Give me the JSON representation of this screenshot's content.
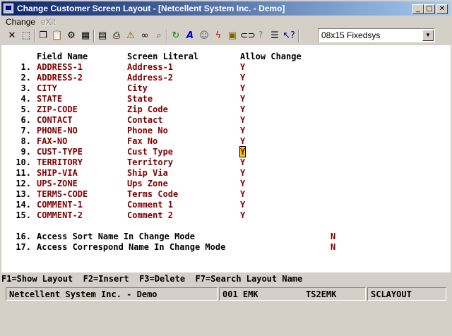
{
  "window": {
    "title": "Change Customer Screen Layout - [Netcellent System Inc. - Demo]"
  },
  "menu": {
    "items": [
      {
        "label": "Change",
        "enabled": true
      },
      {
        "label": "eXit",
        "enabled": false
      }
    ]
  },
  "toolbar": {
    "font_select": "08x15 Fixedsys",
    "icons": [
      "cancel-icon",
      "select-icon",
      "copy-icon",
      "paste-icon",
      "settings-icon",
      "configure-icon",
      "notes-icon",
      "print-icon",
      "alert-icon",
      "binoculars-icon",
      "find-icon",
      "refresh-icon",
      "font-icon",
      "user-icon",
      "lightning-icon",
      "calculator-icon",
      "link-icon",
      "help-icon",
      "list-icon",
      "context-help-icon"
    ]
  },
  "headers": {
    "field": "Field Name",
    "literal": "Screen Literal",
    "allow": "Allow Change"
  },
  "rows": [
    {
      "num": "1.",
      "field": "ADDRESS-1",
      "literal": "Address-1",
      "allow": "Y"
    },
    {
      "num": "2.",
      "field": "ADDRESS-2",
      "literal": "Address-2",
      "allow": "Y"
    },
    {
      "num": "3.",
      "field": "CITY",
      "literal": "City",
      "allow": "Y"
    },
    {
      "num": "4.",
      "field": "STATE",
      "literal": "State",
      "allow": "Y"
    },
    {
      "num": "5.",
      "field": "ZIP-CODE",
      "literal": "Zip Code",
      "allow": "Y"
    },
    {
      "num": "6.",
      "field": "CONTACT",
      "literal": "Contact",
      "allow": "Y"
    },
    {
      "num": "7.",
      "field": "PHONE-NO",
      "literal": "Phone No",
      "allow": "Y"
    },
    {
      "num": "8.",
      "field": "FAX-NO",
      "literal": "Fax No",
      "allow": "Y"
    },
    {
      "num": "9.",
      "field": "CUST-TYPE",
      "literal": "Cust Type",
      "allow": "Y",
      "focused": true
    },
    {
      "num": "10.",
      "field": "TERRITORY",
      "literal": "Territory",
      "allow": "Y"
    },
    {
      "num": "11.",
      "field": "SHIP-VIA",
      "literal": "Ship Via",
      "allow": "Y"
    },
    {
      "num": "12.",
      "field": "UPS-ZONE",
      "literal": "Ups Zone",
      "allow": "Y"
    },
    {
      "num": "13.",
      "field": "TERMS-CODE",
      "literal": "Terms Code",
      "allow": "Y"
    },
    {
      "num": "14.",
      "field": "COMMENT-1",
      "literal": "Comment 1",
      "allow": "Y"
    },
    {
      "num": "15.",
      "field": "COMMENT-2",
      "literal": "Comment 2",
      "allow": "Y"
    }
  ],
  "options": [
    {
      "num": "16.",
      "label": "Access Sort Name In Change Mode",
      "value": "N"
    },
    {
      "num": "17.",
      "label": "Access Correspond Name In Change Mode",
      "value": "N"
    }
  ],
  "function_keys": "F1=Show Layout  F2=Insert  F3=Delete  F7=Search Layout Name",
  "status": {
    "company": "Netcellent System Inc. - Demo",
    "user": "001 EMK",
    "terminal": "TS2EMK",
    "program": "SCLAYOUT"
  },
  "colors": {
    "field_text": "#800000",
    "focus_bg": "#ffcc00",
    "title_start": "#0a246a",
    "title_end": "#a6caf0"
  }
}
